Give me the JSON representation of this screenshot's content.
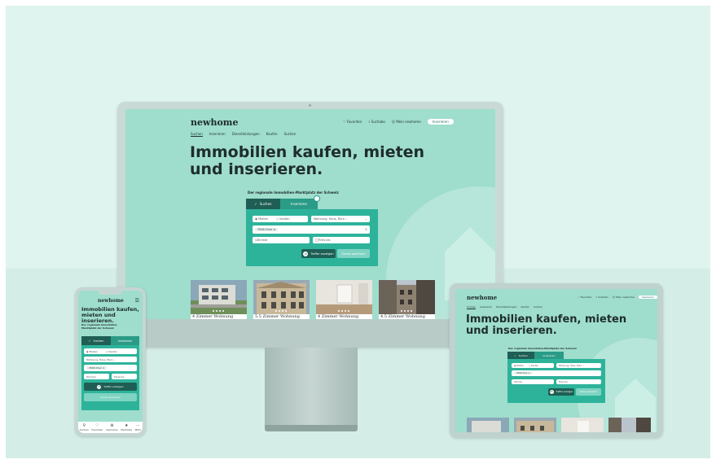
{
  "brand": {
    "logo": "newhome",
    "primary": "#2eb39b",
    "dark": "#1f5e54",
    "background": "#9fddcd"
  },
  "header": {
    "nav": [
      "Suchen",
      "Inserieren",
      "Dienstleistungen",
      "Kaufen",
      "Suchen"
    ],
    "favorites": "Favoriten",
    "alerts": "Suchabo",
    "login": "Mein newhome",
    "cta": "Inserieren"
  },
  "hero": {
    "title_line1": "Immobilien kaufen, mieten",
    "title_line2": "und inserieren.",
    "tagline": "Der regionale Immobilien-Marktplatz der Schweiz"
  },
  "search": {
    "tab_search": "Suchen",
    "tab_list": "Inserieren",
    "radio_rent": "Mieten",
    "radio_buy": "Kaufen",
    "type_placeholder": "Wohnung, Haus, Büro ...",
    "location_chip": "7000 Chur",
    "rooms_placeholder": "Zimmer",
    "price_placeholder": "Preis bis",
    "results_count": "25",
    "results_button": "Treffer anzeigen",
    "save_button": "Suche speichern"
  },
  "listings": [
    {
      "title": "4 Zimmer Wohnung",
      "photo": "modern-building"
    },
    {
      "title": "5.5 Zimmer Wohnung",
      "photo": "historic-building"
    },
    {
      "title": "4 Zimmer Wohnung",
      "photo": "interior"
    },
    {
      "title": "4.5 Zimmer Wohnung",
      "photo": "city-street"
    }
  ],
  "mobile": {
    "hero_title": "Immobilien kaufen, mieten und inserieren.",
    "tagline": "Der regionale Immobilien-Marktplatz der Schweiz",
    "bottom_nav": [
      "Suchen",
      "Favoriten",
      "Inserieren",
      "Merkliste",
      "Mehr"
    ]
  }
}
